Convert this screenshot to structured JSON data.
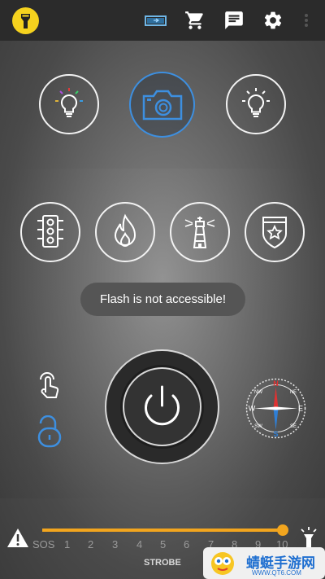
{
  "toast": {
    "message": "Flash is not accessible!"
  },
  "toolbar": {
    "icons": [
      "flashlight-logo",
      "battery-icon",
      "cart-icon",
      "message-icon",
      "settings-icon",
      "more-icon"
    ],
    "accent": "#f5d21e"
  },
  "modes_top": [
    "colored-bulb-icon",
    "camera-icon",
    "bulb-icon"
  ],
  "modes_bottom": [
    "traffic-light-icon",
    "fire-icon",
    "lighthouse-icon",
    "police-badge-icon"
  ],
  "power": {
    "label_icon": "power-icon"
  },
  "compass": {
    "n": "N",
    "s": "S",
    "e": "E",
    "w": "W",
    "ne": "NE",
    "nw": "NW",
    "se": "SE",
    "sw": "SW"
  },
  "slider": {
    "labels": [
      "SOS",
      "1",
      "2",
      "3",
      "4",
      "5",
      "6",
      "7",
      "8",
      "9",
      "10"
    ],
    "value": "10",
    "mode_label": "STROBE",
    "track_color": "#f2a51e"
  },
  "watermark": {
    "text": "蜻蜓手游网",
    "sub": "WWW.QT6.COM"
  }
}
